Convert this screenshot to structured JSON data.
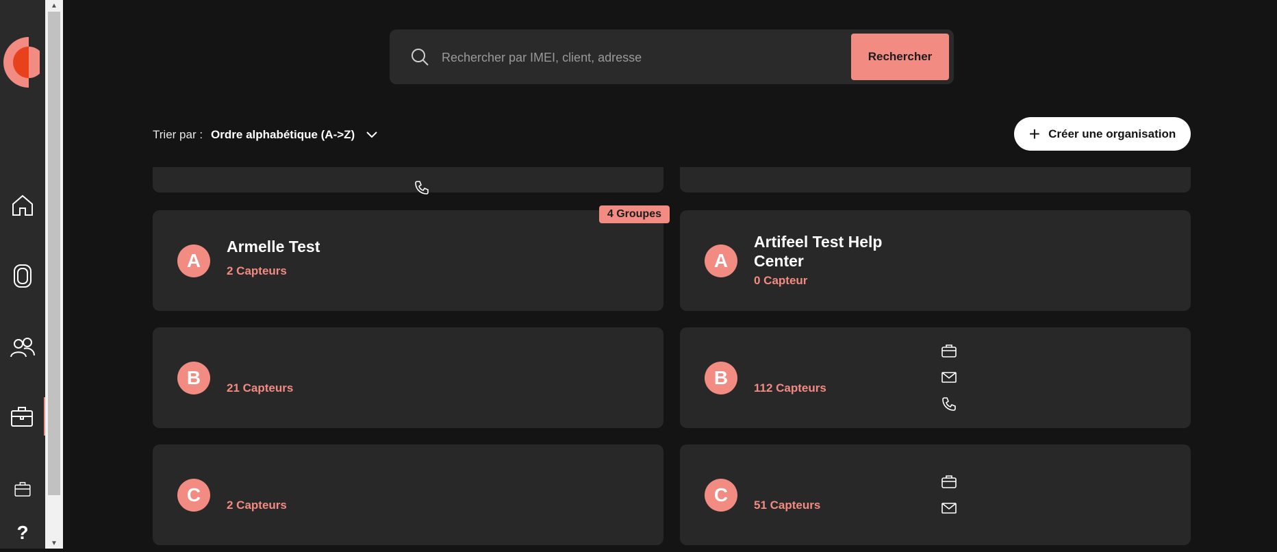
{
  "search": {
    "placeholder": "Rechercher par IMEI, client, adresse",
    "button_label": "Rechercher"
  },
  "sort": {
    "label": "Trier par :",
    "value": "Ordre alphabétique (A->Z)"
  },
  "create_button_label": "Créer une organisation",
  "sidebar": {
    "items": [
      "home-icon",
      "device-icon",
      "users-icon",
      "briefcase-icon",
      "briefcase-small-icon",
      "help-icon"
    ],
    "help_label": "?"
  },
  "organizations": [
    {
      "initial": "A",
      "name": "Armelle Test",
      "count": "2 Capteurs",
      "badge": "4 Groupes"
    },
    {
      "initial": "A",
      "name": "Artifeel Test Help Center",
      "count": "0 Capteur"
    },
    {
      "initial": "B",
      "name": "",
      "count": "21 Capteurs"
    },
    {
      "initial": "B",
      "name": "",
      "count": "112 Capteurs"
    },
    {
      "initial": "C",
      "name": "",
      "count": "2 Capteurs"
    },
    {
      "initial": "C",
      "name": "",
      "count": "51 Capteurs"
    }
  ],
  "colors": {
    "accent": "#f28b82",
    "background": "#141414",
    "card": "#282828",
    "sidebar": "#2a2a2a"
  }
}
